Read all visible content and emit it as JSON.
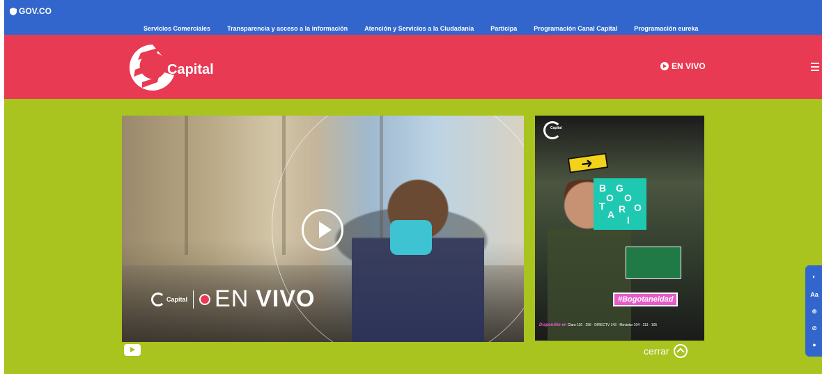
{
  "gov_bar": {
    "logo_text": "GOV.CO",
    "nav": [
      "Servicios Comerciales",
      "Transparencia y acceso a la información",
      "Atención y Servicios a la Ciudadanía",
      "Participa",
      "Programación Canal Capital",
      "Programación eureka"
    ]
  },
  "header": {
    "brand_name": "Capital",
    "live_label": "EN VIVO"
  },
  "video": {
    "overlay_brand": "Capital",
    "overlay_en": "EN",
    "overlay_vivo": "VIVO"
  },
  "promo": {
    "brand": "Capital",
    "tile_letters": [
      "B",
      "O",
      "G",
      "O",
      "T",
      "A",
      "R",
      "I",
      "O"
    ],
    "hashtag": "#Bogotaneidad",
    "available_label": "Disponible en",
    "channels": "Claro 116 · 256 · DIRECTV 143 · Movistar 104 · 113 · 105"
  },
  "close_label": "cerrar",
  "colors": {
    "gov_blue": "#3366cc",
    "header_red": "#e83a53",
    "main_green": "#a9c31f",
    "tile_teal": "#1fc9b1",
    "hashtag_pink": "#e65cc9"
  }
}
